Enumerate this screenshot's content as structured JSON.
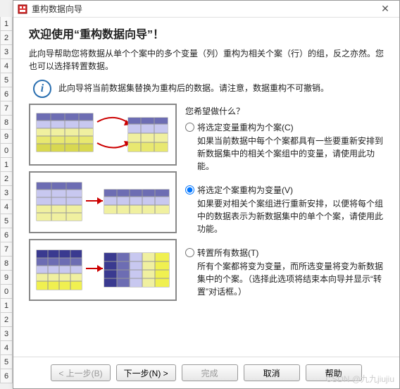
{
  "row_numbers": [
    "1",
    "2",
    "3",
    "4",
    "5",
    "6",
    "7",
    "8",
    "9",
    "0",
    "1",
    "2",
    "3",
    "4",
    "5",
    "6",
    "7",
    "8",
    "9",
    "0",
    "1",
    "2",
    "3",
    "4",
    "5",
    "6"
  ],
  "titlebar": {
    "title": "重构数据向导"
  },
  "heading": "欢迎使用“重构数据向导”！",
  "intro": "此向导帮助您将数据从单个个案中的多个变量（列）重构为相关个案（行）的组，反之亦然。您也可以选择转置数据。",
  "info": "此向导将当前数据集替换为重构后的数据。请注意，数据重构不可撤销。",
  "question": "您希望做什么？",
  "options": [
    {
      "label": "将选定变量重构为个案(C)",
      "desc": "如果当前数据中每个个案都具有一些要重新安排到新数据集中的相关个案组中的变量，请使用此功能。",
      "checked": false
    },
    {
      "label": "将选定个案重构为变量(V)",
      "desc": "如果要对相关个案组进行重新安排，以便将每个组中的数据表示为新数据集中的单个个案，请使用此功能。",
      "checked": true
    },
    {
      "label": "转置所有数据(T)",
      "desc": "所有个案都将变为变量，而所选变量将变为新数据集中的个案。（选择此选项将结束本向导并显示“转置”对话框。）",
      "checked": false
    }
  ],
  "buttons": {
    "back": "< 上一步(B)",
    "next": "下一步(N) >",
    "finish": "完成",
    "cancel": "取消",
    "help": "帮助"
  },
  "watermark": "CSDN @九九jiujiu"
}
